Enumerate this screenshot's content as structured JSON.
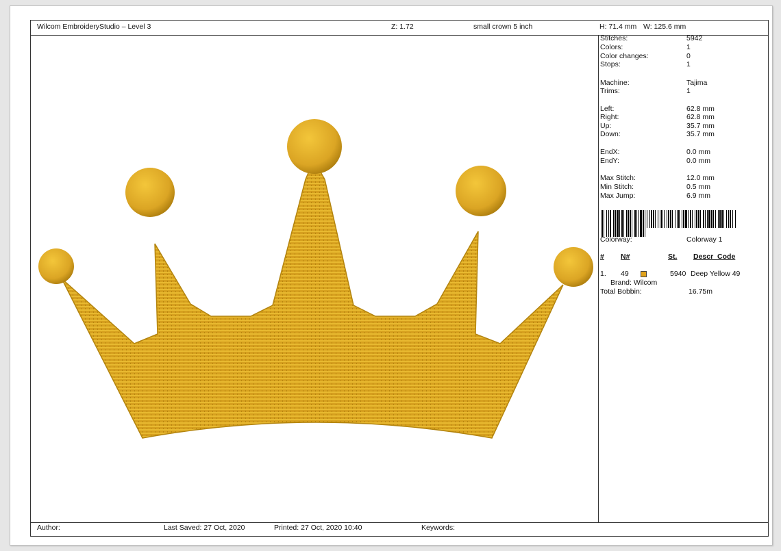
{
  "header": {
    "app_title": "Wilcom EmbroideryStudio – Level 3",
    "zoom": "Z: 1.72",
    "design_name": "small crown 5 inch",
    "height": "H: 71.4 mm",
    "width": "W: 125.6 mm"
  },
  "stats": [
    {
      "label": "Stitches:",
      "value": "5942"
    },
    {
      "label": "Colors:",
      "value": "1"
    },
    {
      "label": "Color changes:",
      "value": "0"
    },
    {
      "label": "Stops:",
      "value": "1"
    },
    {
      "label": "Machine:",
      "value": "Tajima"
    },
    {
      "label": "Trims:",
      "value": "1"
    },
    {
      "label": "Left:",
      "value": "62.8 mm"
    },
    {
      "label": "Right:",
      "value": "62.8 mm"
    },
    {
      "label": "Up:",
      "value": "35.7 mm"
    },
    {
      "label": "Down:",
      "value": "35.7 mm"
    },
    {
      "label": "EndX:",
      "value": "0.0 mm"
    },
    {
      "label": "EndY:",
      "value": "0.0 mm"
    },
    {
      "label": "Max Stitch:",
      "value": "12.0 mm"
    },
    {
      "label": "Min Stitch:",
      "value": "0.5 mm"
    },
    {
      "label": "Max Jump:",
      "value": "6.9 mm"
    }
  ],
  "colorway": {
    "label": "Colorway:",
    "value": "Colorway 1"
  },
  "color_table": {
    "headers": {
      "num": "#",
      "n": "N#",
      "st": "St.",
      "descr": "Descr_Code"
    },
    "rows": [
      {
        "num": "1.",
        "n": "49",
        "swatch_color": "#e0a21c",
        "st": "5940",
        "descr": "Deep Yellow 49"
      }
    ],
    "brand": "Brand: Wilcom",
    "total_bobbin_label": "Total Bobbin:",
    "total_bobbin_value": "16.75m"
  },
  "footer": {
    "author": "Author:",
    "last_saved": "Last Saved: 27 Oct, 2020",
    "printed": "Printed: 27 Oct, 2020 10:40",
    "keywords": "Keywords:"
  },
  "design": {
    "shape": "crown-embroidery",
    "thread_color": "#d9a521",
    "highlight_color": "#f3c63a",
    "shadow_color": "#a97a0c"
  }
}
